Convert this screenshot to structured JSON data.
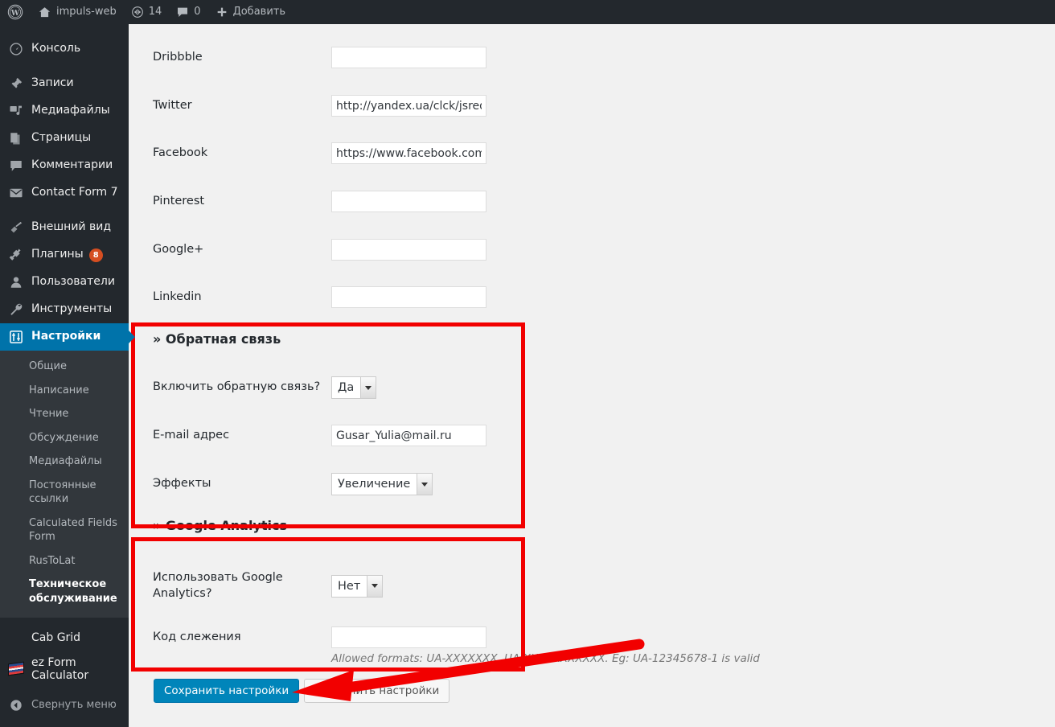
{
  "adminbar": {
    "logo_icon": "wordpress-logo-icon",
    "items": [
      {
        "icon": "home-icon",
        "label": "impuls-web"
      },
      {
        "icon": "updates-icon",
        "label": "14"
      },
      {
        "icon": "comment-bubble-icon",
        "label": "0"
      },
      {
        "icon": "plus-icon",
        "label": "Добавить"
      }
    ]
  },
  "sidebar": {
    "menu": [
      {
        "icon": "dashboard-icon",
        "label": "Консоль",
        "current": false,
        "badge": ""
      },
      {
        "icon": "pin-icon",
        "label": "Записи",
        "current": false,
        "badge": ""
      },
      {
        "icon": "media-icon",
        "label": "Медиафайлы",
        "current": false,
        "badge": ""
      },
      {
        "icon": "pages-icon",
        "label": "Страницы",
        "current": false,
        "badge": ""
      },
      {
        "icon": "comments-icon",
        "label": "Комментарии",
        "current": false,
        "badge": ""
      },
      {
        "icon": "envelope-icon",
        "label": "Contact Form 7",
        "current": false,
        "badge": ""
      },
      {
        "icon": "appearance-brush-icon",
        "label": "Внешний вид",
        "current": false,
        "badge": ""
      },
      {
        "icon": "plugins-plug-icon",
        "label": "Плагины",
        "current": false,
        "badge": "8"
      },
      {
        "icon": "users-icon",
        "label": "Пользователи",
        "current": false,
        "badge": ""
      },
      {
        "icon": "tools-wrench-icon",
        "label": "Инструменты",
        "current": false,
        "badge": ""
      },
      {
        "icon": "settings-sliders-icon",
        "label": "Настройки",
        "current": true,
        "badge": ""
      }
    ],
    "submenu": [
      {
        "label": "Общие",
        "current": false
      },
      {
        "label": "Написание",
        "current": false
      },
      {
        "label": "Чтение",
        "current": false
      },
      {
        "label": "Обсуждение",
        "current": false
      },
      {
        "label": "Медиафайлы",
        "current": false
      },
      {
        "label": "Постоянные ссылки",
        "current": false
      },
      {
        "label": "Calculated Fields Form",
        "current": false
      },
      {
        "label": "RusToLat",
        "current": false
      },
      {
        "label": "Техническое обслуживание",
        "current": true
      }
    ],
    "plugins": [
      {
        "icon": "",
        "label": "Cab Grid"
      },
      {
        "icon": "ez-form-calculator-icon",
        "label": "ez Form Calculator"
      }
    ],
    "collapse": {
      "icon": "collapse-arrow-icon",
      "label": "Свернуть меню"
    }
  },
  "main": {
    "social_fields": [
      {
        "label": "Dribbble",
        "value": "",
        "placeholder": ""
      },
      {
        "label": "Twitter",
        "value": "http://yandex.ua/clck/jsred",
        "placeholder": ""
      },
      {
        "label": "Facebook",
        "value": "https://www.facebook.com/",
        "placeholder": ""
      },
      {
        "label": "Pinterest",
        "value": "",
        "placeholder": ""
      },
      {
        "label": "Google+",
        "value": "",
        "placeholder": ""
      },
      {
        "label": "Linkedin",
        "value": "",
        "placeholder": ""
      }
    ],
    "feedback_section": {
      "chevron": "»",
      "title": "Обратная связь",
      "enable_label": "Включить обратную связь?",
      "enable_value": "Да",
      "email_label": "E-mail адрес",
      "email_value": "Gusar_Yulia@mail.ru",
      "effects_label": "Эффекты",
      "effects_value": "Увеличение"
    },
    "analytics_section": {
      "chevron": "»",
      "title": "Google Analytics",
      "use_label": "Использовать Google Analytics?",
      "use_value": "Нет",
      "code_label": "Код слежения",
      "code_value": "",
      "hint": "Allowed formats: UA-XXXXXXX, UA-XXXXXXXXXXX. Eg: UA-12345678-1 is valid"
    },
    "buttons": {
      "save_primary": "Сохранить настройки",
      "save_secondary": "Сохранить настройки"
    }
  },
  "annotations": {
    "highlight_color": "#f20000",
    "arrow_color": "#f20000"
  }
}
